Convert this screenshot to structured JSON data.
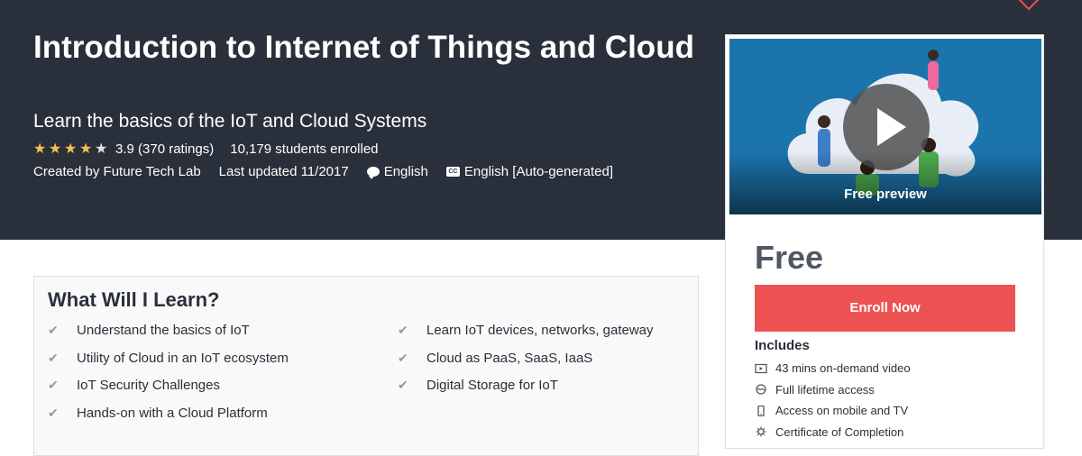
{
  "header": {
    "title": "Introduction to Internet of Things and Cloud",
    "subtitle": "Learn the basics of the IoT and Cloud Systems",
    "rating": 3.9,
    "rating_text": "3.9 (370 ratings)",
    "students": "10,179 students enrolled",
    "created_by": "Created by Future Tech Lab",
    "last_updated": "Last updated 11/2017",
    "language": "English",
    "captions": "English [Auto-generated]",
    "colors": {
      "background": "#29303b",
      "star": "#f4c150",
      "wishlist": "#ec5252"
    }
  },
  "sidebar": {
    "preview_label": "Free preview",
    "price": "Free",
    "enroll_label": "Enroll Now",
    "includes_title": "Includes",
    "includes": [
      {
        "icon": "video-icon",
        "label": "43 mins on-demand video"
      },
      {
        "icon": "infinity-icon",
        "label": "Full lifetime access"
      },
      {
        "icon": "mobile-icon",
        "label": "Access on mobile and TV"
      },
      {
        "icon": "certificate-icon",
        "label": "Certificate of Completion"
      }
    ],
    "colors": {
      "enroll": "#ec5252",
      "price": "#505763"
    }
  },
  "learn": {
    "title": "What Will I Learn?",
    "left": [
      "Understand the basics of IoT",
      "Utility of Cloud in an IoT ecosystem",
      "IoT Security Challenges",
      "Hands-on with a Cloud Platform"
    ],
    "right": [
      "Learn IoT devices, networks, gateway",
      "Cloud as PaaS, SaaS, IaaS",
      "Digital Storage for IoT"
    ]
  }
}
